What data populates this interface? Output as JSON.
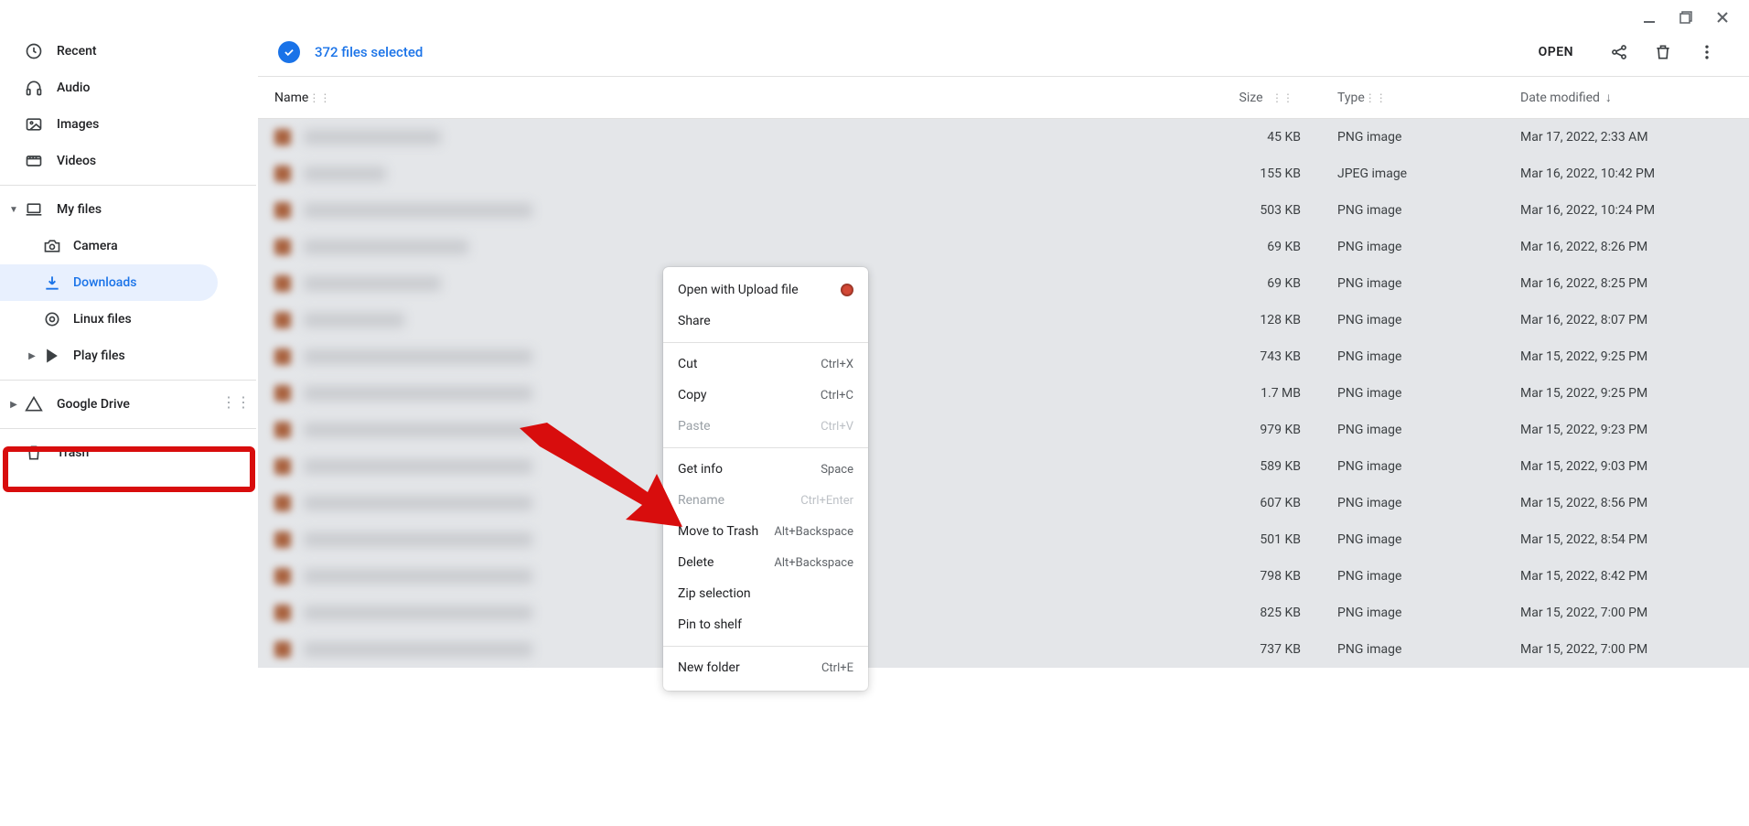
{
  "window_controls": {
    "minimize": "–",
    "maximize": "❐",
    "close": "✕"
  },
  "sidebar": {
    "items": [
      {
        "id": "recent",
        "label": "Recent"
      },
      {
        "id": "audio",
        "label": "Audio"
      },
      {
        "id": "images",
        "label": "Images"
      },
      {
        "id": "videos",
        "label": "Videos"
      }
    ],
    "myfiles": {
      "label": "My files",
      "children": [
        {
          "id": "camera",
          "label": "Camera"
        },
        {
          "id": "downloads",
          "label": "Downloads",
          "active": true
        },
        {
          "id": "linux",
          "label": "Linux files"
        },
        {
          "id": "play",
          "label": "Play files",
          "caret": true
        }
      ]
    },
    "gdrive": {
      "label": "Google Drive"
    },
    "trash": {
      "label": "Trash"
    }
  },
  "header": {
    "selection": "372 files selected",
    "open": "OPEN"
  },
  "columns": {
    "name": "Name",
    "size": "Size",
    "type": "Type",
    "date": "Date modified"
  },
  "rows": [
    {
      "size": "45 KB",
      "type": "PNG image",
      "date": "Mar 17, 2022, 2:33 AM",
      "nw": 150
    },
    {
      "size": "155 KB",
      "type": "JPEG image",
      "date": "Mar 16, 2022, 10:42 PM",
      "nw": 90
    },
    {
      "size": "503 KB",
      "type": "PNG image",
      "date": "Mar 16, 2022, 10:24 PM",
      "nw": 250
    },
    {
      "size": "69 KB",
      "type": "PNG image",
      "date": "Mar 16, 2022, 8:26 PM",
      "nw": 180
    },
    {
      "size": "69 KB",
      "type": "PNG image",
      "date": "Mar 16, 2022, 8:25 PM",
      "nw": 150
    },
    {
      "size": "128 KB",
      "type": "PNG image",
      "date": "Mar 16, 2022, 8:07 PM",
      "nw": 110
    },
    {
      "size": "743 KB",
      "type": "PNG image",
      "date": "Mar 15, 2022, 9:25 PM",
      "nw": 250
    },
    {
      "size": "1.7 MB",
      "type": "PNG image",
      "date": "Mar 15, 2022, 9:25 PM",
      "nw": 250
    },
    {
      "size": "979 KB",
      "type": "PNG image",
      "date": "Mar 15, 2022, 9:23 PM",
      "nw": 250
    },
    {
      "size": "589 KB",
      "type": "PNG image",
      "date": "Mar 15, 2022, 9:03 PM",
      "nw": 250
    },
    {
      "size": "607 KB",
      "type": "PNG image",
      "date": "Mar 15, 2022, 8:56 PM",
      "nw": 250
    },
    {
      "size": "501 KB",
      "type": "PNG image",
      "date": "Mar 15, 2022, 8:54 PM",
      "nw": 250
    },
    {
      "size": "798 KB",
      "type": "PNG image",
      "date": "Mar 15, 2022, 8:42 PM",
      "nw": 250
    },
    {
      "size": "825 KB",
      "type": "PNG image",
      "date": "Mar 15, 2022, 7:00 PM",
      "nw": 250
    },
    {
      "size": "737 KB",
      "type": "PNG image",
      "date": "Mar 15, 2022, 7:00 PM",
      "nw": 250
    }
  ],
  "context_menu": {
    "groups": [
      [
        {
          "label": "Open with Upload file",
          "icon": "bug"
        },
        {
          "label": "Share"
        }
      ],
      [
        {
          "label": "Cut",
          "shortcut": "Ctrl+X"
        },
        {
          "label": "Copy",
          "shortcut": "Ctrl+C"
        },
        {
          "label": "Paste",
          "shortcut": "Ctrl+V",
          "disabled": true
        }
      ],
      [
        {
          "label": "Get info",
          "shortcut": "Space"
        },
        {
          "label": "Rename",
          "shortcut": "Ctrl+Enter",
          "disabled": true
        },
        {
          "label": "Move to Trash",
          "shortcut": "Alt+Backspace"
        },
        {
          "label": "Delete",
          "shortcut": "Alt+Backspace"
        },
        {
          "label": "Zip selection"
        },
        {
          "label": "Pin to shelf"
        }
      ],
      [
        {
          "label": "New folder",
          "shortcut": "Ctrl+E"
        }
      ]
    ]
  }
}
